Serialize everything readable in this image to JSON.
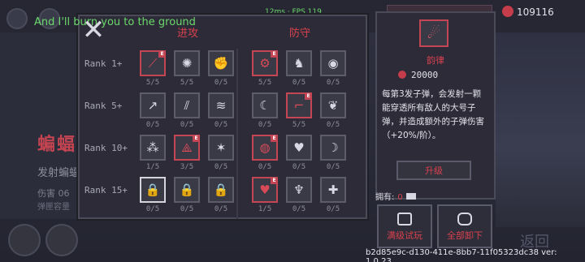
{
  "hud": {
    "chat": "And I'll burn you to the ground",
    "fps": "12ms · FPS 119",
    "coins": "109116",
    "version": "b2d85e9c-d130-411e-8bb7-11f05323dc38 ver: 1.0.23"
  },
  "background": {
    "title": "蝙蝠杉",
    "subtitle": "发射蝙蝠",
    "stat1": "伤害   06",
    "stat2": "弹匣容量",
    "return_label": "返回"
  },
  "panel": {
    "close_label": "✕",
    "col_attack": "进攻",
    "col_defense": "防守",
    "ranks": [
      "Rank 1+",
      "Rank 5+",
      "Rank 10+",
      "Rank 15+"
    ],
    "rows": [
      [
        {
          "icon": "slash-icon",
          "glyph": "⟋",
          "count": "5/5",
          "style": "red"
        },
        {
          "icon": "spiral-icon",
          "glyph": "✺",
          "count": "5/5",
          "style": ""
        },
        {
          "icon": "fist-icon",
          "glyph": "✊",
          "count": "0/5",
          "style": ""
        },
        {
          "icon": "shield-gear-icon",
          "glyph": "⚙",
          "count": "5/5",
          "style": "red"
        },
        {
          "icon": "figure-icon",
          "glyph": "♞",
          "count": "0/5",
          "style": ""
        },
        {
          "icon": "eye-icon",
          "glyph": "◉",
          "count": "0/5",
          "style": ""
        }
      ],
      [
        {
          "icon": "arrows-icon",
          "glyph": "↗",
          "count": "0/5",
          "style": ""
        },
        {
          "icon": "claw-icon",
          "glyph": "⫽",
          "count": "0/5",
          "style": ""
        },
        {
          "icon": "wind-icon",
          "glyph": "≋",
          "count": "0/5",
          "style": ""
        },
        {
          "icon": "moon-icon",
          "glyph": "☾",
          "count": "0/5",
          "style": ""
        },
        {
          "icon": "boot-icon",
          "glyph": "⌐",
          "count": "5/5",
          "style": "red"
        },
        {
          "icon": "leaf-icon",
          "glyph": "❦",
          "count": "0/5",
          "style": ""
        }
      ],
      [
        {
          "icon": "drops-icon",
          "glyph": "⁂",
          "count": "1/5",
          "style": ""
        },
        {
          "icon": "tri-icon",
          "glyph": "⟁",
          "count": "3/5",
          "style": "red"
        },
        {
          "icon": "burst-icon",
          "glyph": "✶",
          "count": "0/5",
          "style": ""
        },
        {
          "icon": "orb-icon",
          "glyph": "◍",
          "count": "0/5",
          "style": "red"
        },
        {
          "icon": "hearts-icon",
          "glyph": "♥",
          "count": "0/5",
          "style": ""
        },
        {
          "icon": "scythe-icon",
          "glyph": "☽",
          "count": "0/5",
          "style": ""
        }
      ],
      [
        {
          "icon": "locked-bat-icon",
          "glyph": "🔒",
          "count": "0/5",
          "style": "white"
        },
        {
          "icon": "locked-icon",
          "glyph": "🔒",
          "count": "0/5",
          "style": ""
        },
        {
          "icon": "locked-icon",
          "glyph": "🔒",
          "count": "0/5",
          "style": ""
        },
        {
          "icon": "heart-cross-icon",
          "glyph": "♥",
          "count": "1/5",
          "style": "red"
        },
        {
          "icon": "angel-icon",
          "glyph": "♆",
          "count": "0/5",
          "style": ""
        },
        {
          "icon": "cross-flower-icon",
          "glyph": "✚",
          "count": "0/5",
          "style": ""
        }
      ]
    ]
  },
  "detail": {
    "icon": "comet-icon",
    "name": "韵律",
    "cost": "20000",
    "description": "每第3发子弹，会发射一颗能穿透所有敌人的大号子弹，并造成额外的子弹伤害（+20%/阶）。",
    "upgrade_label": "升级",
    "owned_label": "拥有:",
    "owned_count": "0",
    "try_label": "满级试玩",
    "unload_label": "全部卸下"
  },
  "colors": {
    "accent_red": "#d8414e",
    "panel_bg": "#2c2b37",
    "border": "#4a4a58"
  }
}
